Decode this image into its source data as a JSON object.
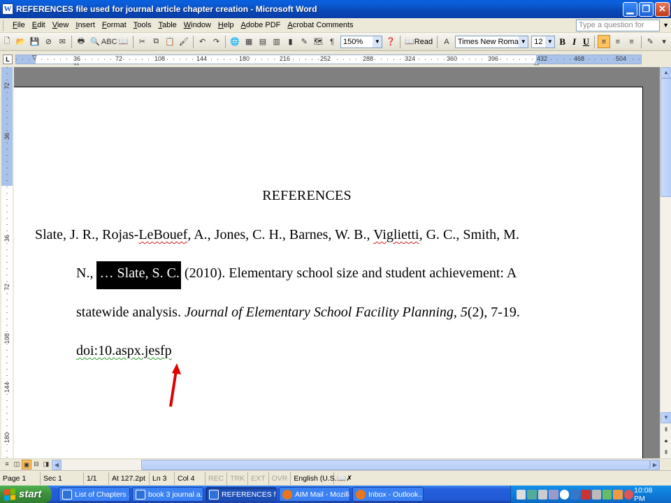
{
  "window": {
    "title": "REFERENCES file used for journal article chapter creation - Microsoft Word",
    "app_icon_letter": "W"
  },
  "menu": {
    "items": [
      "File",
      "Edit",
      "View",
      "Insert",
      "Format",
      "Tools",
      "Table",
      "Window",
      "Help",
      "Adobe PDF",
      "Acrobat Comments"
    ],
    "help_placeholder": "Type a question for help"
  },
  "toolbar": {
    "zoom": "150%",
    "read_label": "Read",
    "font_name": "Times New Roman",
    "font_size": "12",
    "bold_label": "B",
    "italic_label": "I",
    "underline_label": "U"
  },
  "ruler": {
    "numbers": [
      "36",
      "72",
      "108",
      "144",
      "180",
      "216",
      "252",
      "288",
      "324",
      "360",
      "396",
      "432",
      "468",
      "504"
    ]
  },
  "vruler": {
    "numbers": [
      "72",
      "36",
      "36",
      "72",
      "108",
      "144",
      "180"
    ]
  },
  "document": {
    "heading": "REFERENCES",
    "line1_a": "Slate, J. R., Rojas-",
    "line1_b": "LeBouef",
    "line1_c": ", A., Jones, C. H., Barnes, W. B., ",
    "line1_d": "Viglietti",
    "line1_e": ", G. C., Smith, M.",
    "line2_a": "N., ",
    "line2_highlight": "… Slate, S. C.",
    "line2_b": " (2010). Elementary school size and student achievement: A",
    "line3_a": "statewide analysis. ",
    "line3_italic": "Journal of Elementary School Facility Planning, 5",
    "line3_b": "(2), 7-19.",
    "line4": "doi:10.aspx.jesfp"
  },
  "status": {
    "page": "Page 1",
    "section": "Sec 1",
    "pages": "1/1",
    "at": "At 127.2pt",
    "ln": "Ln 3",
    "col": "Col 4",
    "rec": "REC",
    "trk": "TRK",
    "ext": "EXT",
    "ovr": "OVR",
    "language": "English (U.S."
  },
  "taskbar": {
    "start_label": "start",
    "tasks": [
      {
        "label": "List of Chapters ...",
        "color": "#2F6FD8"
      },
      {
        "label": "book 3 journal a...",
        "color": "#2F6FD8"
      },
      {
        "label": "REFERENCES fil...",
        "color": "#2F6FD8"
      },
      {
        "label": "AIM Mail - Mozilla...",
        "color": "#E8761C"
      },
      {
        "label": "Inbox - Outlook...",
        "color": "#E8761C"
      }
    ],
    "clock": "10:08 PM"
  },
  "colors": {
    "titlebar": "#0A3EA8",
    "highlight_bg": "#000000",
    "arrow": "#E00000",
    "spell_squiggle": "#D02020"
  }
}
